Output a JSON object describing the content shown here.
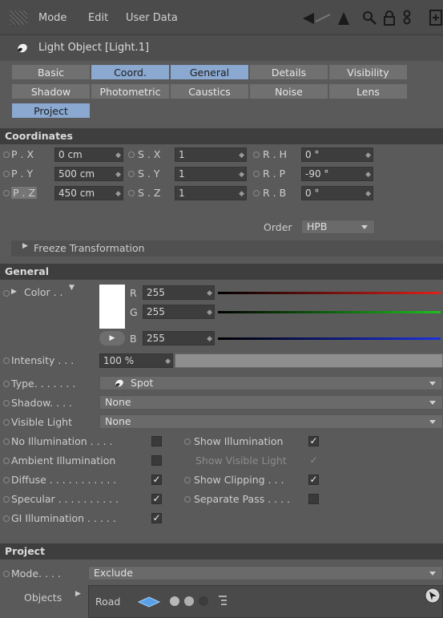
{
  "menu": {
    "mode": "Mode",
    "edit": "Edit",
    "user_data": "User Data"
  },
  "object_title": "Light Object [Light.1]",
  "tabs_row1": [
    "Basic",
    "Coord.",
    "General",
    "Details",
    "Visibility"
  ],
  "tabs_row2": [
    "Shadow",
    "Photometric",
    "Caustics",
    "Noise",
    "Lens"
  ],
  "tabs_row3": [
    "Project"
  ],
  "coordinates": {
    "title": "Coordinates",
    "px_label": "P . X",
    "px": "0 cm",
    "py_label": "P . Y",
    "py": "500 cm",
    "pz_label": "P . Z",
    "pz": "450 cm",
    "sx_label": "S . X",
    "sx": "1",
    "sy_label": "S . Y",
    "sy": "1",
    "sz_label": "S . Z",
    "sz": "1",
    "rh_label": "R . H",
    "rh": "0 °",
    "rp_label": "R . P",
    "rp": "-90 °",
    "rb_label": "R . B",
    "rb": "0 °",
    "order_label": "Order",
    "order": "HPB",
    "freeze": "Freeze Transformation"
  },
  "general": {
    "title": "General",
    "color_label": "Color . .",
    "r_label": "R",
    "r": "255",
    "g_label": "G",
    "g": "255",
    "b_label": "B",
    "b": "255",
    "intensity_label": "Intensity . . .",
    "intensity": "100 %",
    "type_label": "Type. . . . . . .",
    "type": "Spot",
    "shadow_label": "Shadow. . . .",
    "shadow": "None",
    "visible_light_label": "Visible Light",
    "visible_light": "None",
    "no_illumination": "No Illumination . . . .",
    "show_illumination": "Show Illumination",
    "ambient_illumination": "Ambient Illumination",
    "show_visible_light": "Show Visible Light",
    "diffuse": "Diffuse . . . . . . . . . . .",
    "show_clipping": "Show Clipping . . .",
    "specular": "Specular . . . . . . . . . .",
    "separate_pass": "Separate Pass . . . .",
    "gi_illumination": "GI Illumination . . . . ."
  },
  "project": {
    "title": "Project",
    "mode_label": "Mode. . . .",
    "mode": "Exclude",
    "objects_label": "Objects",
    "object_item": "Road"
  },
  "colors": {
    "accent": "#8aa8d0",
    "red": "#e0201a",
    "green": "#1ec01e",
    "blue": "#1a30e0"
  }
}
